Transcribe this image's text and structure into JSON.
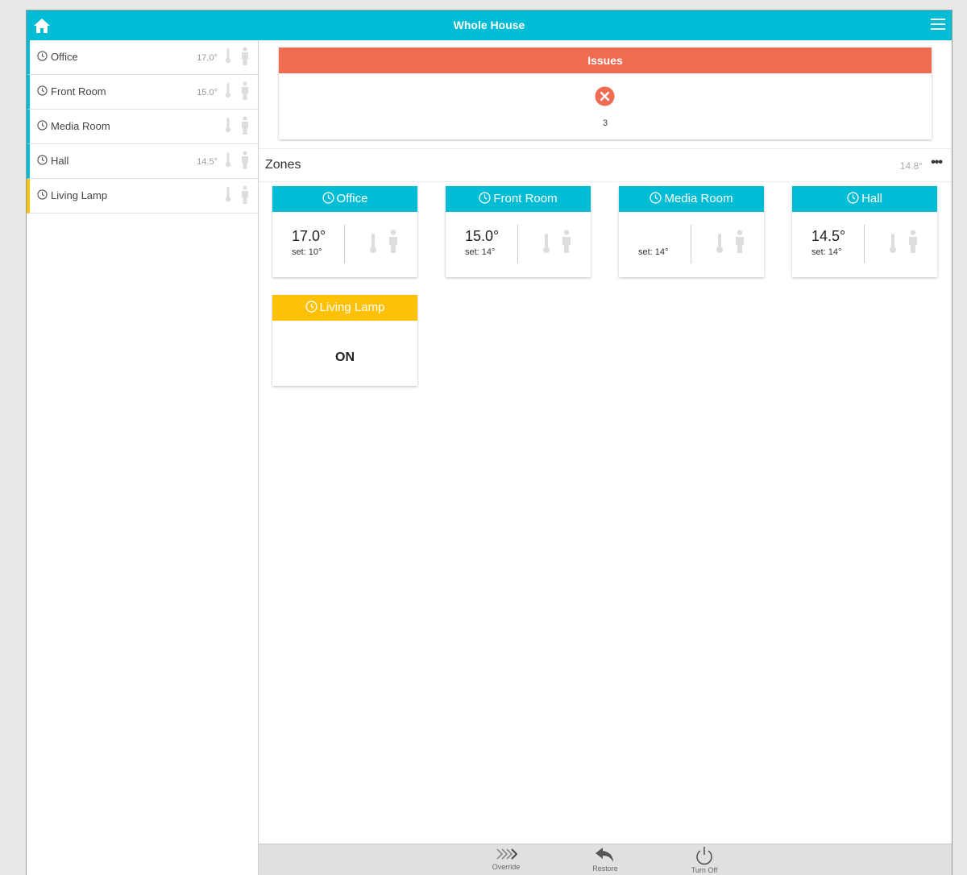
{
  "header": {
    "title": "Whole House",
    "home_icon": "home-icon",
    "menu_icon": "hamburger-menu-icon"
  },
  "sidebar": {
    "items": [
      {
        "label": "Office",
        "temp": "17.0°",
        "accent": "#00bcd4"
      },
      {
        "label": "Front Room",
        "temp": "15.0°",
        "accent": "#00bcd4"
      },
      {
        "label": "Media Room",
        "temp": "",
        "accent": "#00bcd4"
      },
      {
        "label": "Hall",
        "temp": "14.5°",
        "accent": "#00bcd4"
      },
      {
        "label": "Living Lamp",
        "temp": "",
        "accent": "#ffc107"
      }
    ]
  },
  "issues": {
    "title": "Issues",
    "count": "3",
    "color": "#ef6c52"
  },
  "zones": {
    "label": "Zones",
    "temp": "14.8°",
    "more": "•••",
    "cards": [
      {
        "title": "Office",
        "temp": "17.0°",
        "set": "set: 10°"
      },
      {
        "title": "Front Room",
        "temp": "15.0°",
        "set": "set: 14°"
      },
      {
        "title": "Media Room",
        "temp": "",
        "set": "set: 14°"
      },
      {
        "title": "Hall",
        "temp": "14.5°",
        "set": "set: 14°"
      }
    ],
    "lamp": {
      "title": "Living Lamp",
      "state": "ON"
    }
  },
  "toolbar": {
    "override": "Override",
    "restore": "Restore",
    "turn_off": "Turn Off"
  },
  "colors": {
    "accent": "#00bcd4",
    "amber": "#ffc107",
    "issue": "#ef6c52"
  }
}
